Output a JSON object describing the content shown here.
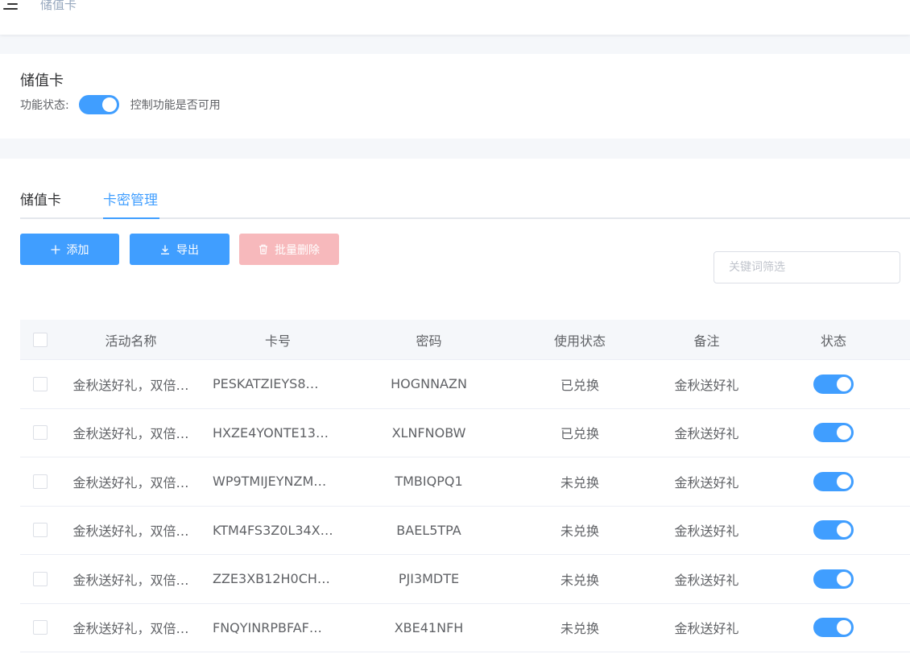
{
  "header": {
    "breadcrumb": "储值卡",
    "menu_icon": "hamburger-icon"
  },
  "feature": {
    "title": "储值卡",
    "status_label": "功能状态:",
    "status_on": true,
    "status_desc": "控制功能是否可用"
  },
  "tabs": [
    {
      "label": "储值卡",
      "active": false
    },
    {
      "label": "卡密管理",
      "active": true
    }
  ],
  "toolbar": {
    "add_label": "添加",
    "export_label": "导出",
    "batch_delete_label": "批量删除",
    "search_placeholder": "关键词筛选"
  },
  "table": {
    "columns": [
      "活动名称",
      "卡号",
      "密码",
      "使用状态",
      "备注",
      "状态"
    ],
    "rows": [
      {
        "name": "金秋送好礼，双倍…",
        "card": "PESKATZIEYS8…",
        "password": "HOGNNAZN",
        "usage": "已兑换",
        "remark": "金秋送好礼",
        "enabled": true
      },
      {
        "name": "金秋送好礼，双倍…",
        "card": "HXZE4YONTE13…",
        "password": "XLNFNOBW",
        "usage": "已兑换",
        "remark": "金秋送好礼",
        "enabled": true
      },
      {
        "name": "金秋送好礼，双倍…",
        "card": "WP9TMIJEYNZM…",
        "password": "TMBIQPQ1",
        "usage": "未兑换",
        "remark": "金秋送好礼",
        "enabled": true
      },
      {
        "name": "金秋送好礼，双倍…",
        "card": "KTM4FS3Z0L34X…",
        "password": "BAEL5TPA",
        "usage": "未兑换",
        "remark": "金秋送好礼",
        "enabled": true
      },
      {
        "name": "金秋送好礼，双倍…",
        "card": "ZZE3XB12H0CH…",
        "password": "PJI3MDTE",
        "usage": "未兑换",
        "remark": "金秋送好礼",
        "enabled": true
      },
      {
        "name": "金秋送好礼，双倍…",
        "card": "FNQYINRPBFAF…",
        "password": "XBE41NFH",
        "usage": "未兑换",
        "remark": "金秋送好礼",
        "enabled": true
      }
    ]
  },
  "colors": {
    "primary": "#409eff",
    "danger_disabled": "#f7b9bc",
    "background": "#f5f7fa"
  }
}
